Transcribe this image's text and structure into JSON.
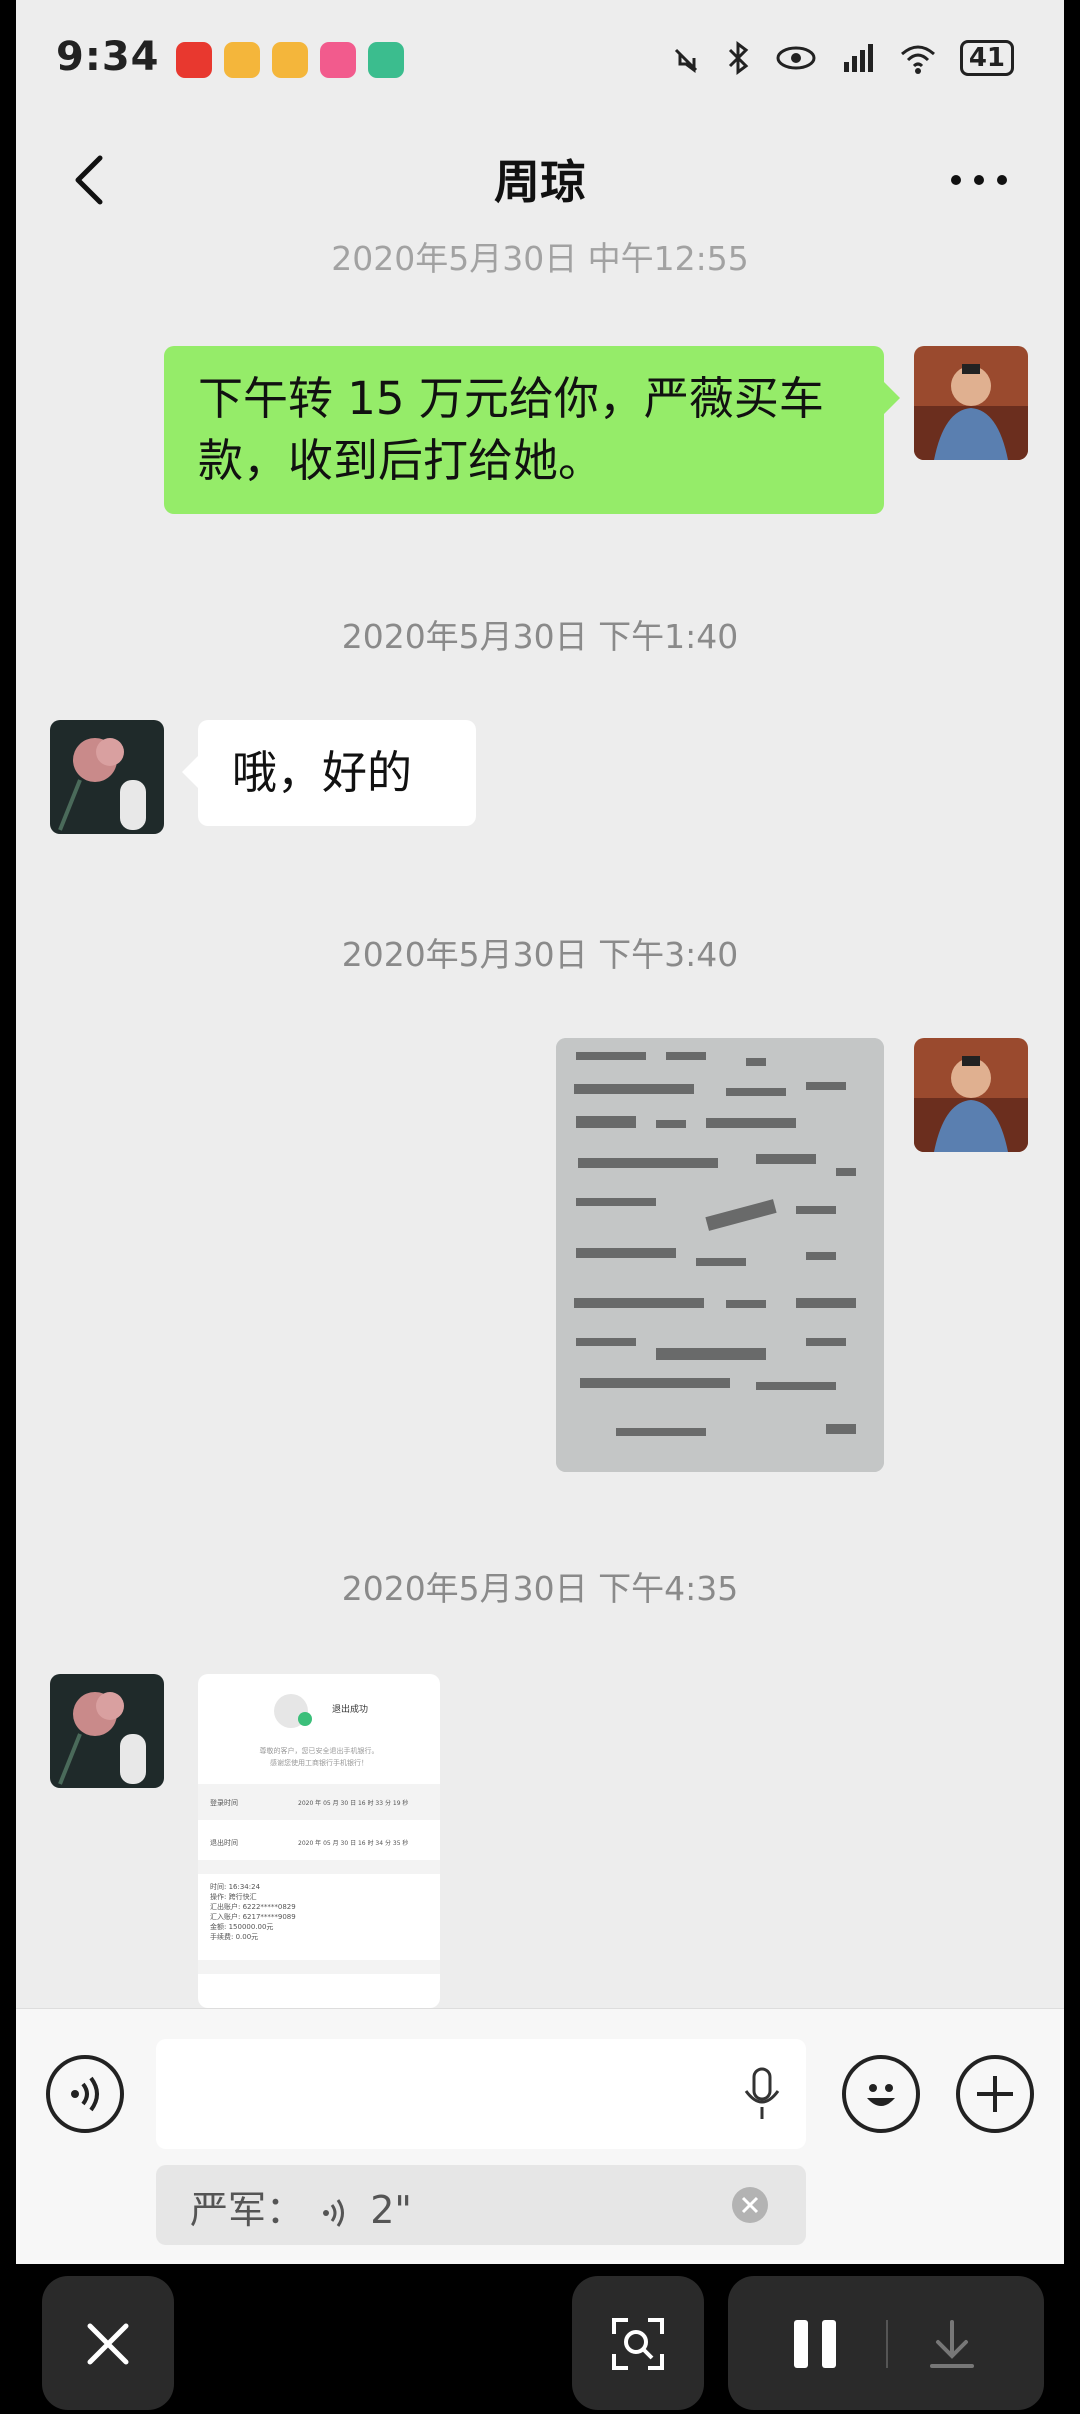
{
  "status_bar": {
    "time": "9:34",
    "battery": "41",
    "app_icons": [
      "huawei-app-icon",
      "weibo-icon",
      "weibo-icon",
      "bilibili-icon",
      "app-icon"
    ]
  },
  "header": {
    "title": "周琼"
  },
  "messages": [
    {
      "type": "timestamp",
      "text": "2020年5月30日 中午12:55"
    },
    {
      "type": "text",
      "side": "me",
      "text": "下午转 15 万元给你，严薇买车款，收到后打给她。"
    },
    {
      "type": "timestamp",
      "text": "2020年5月30日 下午1:40"
    },
    {
      "type": "text",
      "side": "them",
      "text": "哦，好的"
    },
    {
      "type": "timestamp",
      "text": "2020年5月30日 下午3:40"
    },
    {
      "type": "image",
      "side": "me"
    },
    {
      "type": "timestamp",
      "text": "2020年5月30日 下午4:35"
    },
    {
      "type": "image",
      "side": "them"
    }
  ],
  "receipt": {
    "title": "退出成功",
    "line1": "尊敬的客户，您已安全退出手机银行。",
    "line2": "感谢您使用工商银行手机银行！",
    "login_label": "登录时间",
    "login_value": "2020 年 05 月 30 日 16 时 33 分 19 秒",
    "logout_label": "退出时间",
    "logout_value": "2020 年 05 月 30 日 16 时 34 分 35 秒",
    "details": [
      "时间: 16:34:24",
      "操作: 跨行快汇",
      "汇出账户: 6222*****0829",
      "汇入账户: 6217*****9089",
      "金额: 150000.00元",
      "手续费: 0.00元"
    ]
  },
  "input_bar": {
    "quote_text": "严军：",
    "quote_voice_duration": "2\""
  },
  "colors": {
    "chat_bg": "#ededed",
    "my_bubble": "#95ec69",
    "their_bubble": "#ffffff"
  }
}
